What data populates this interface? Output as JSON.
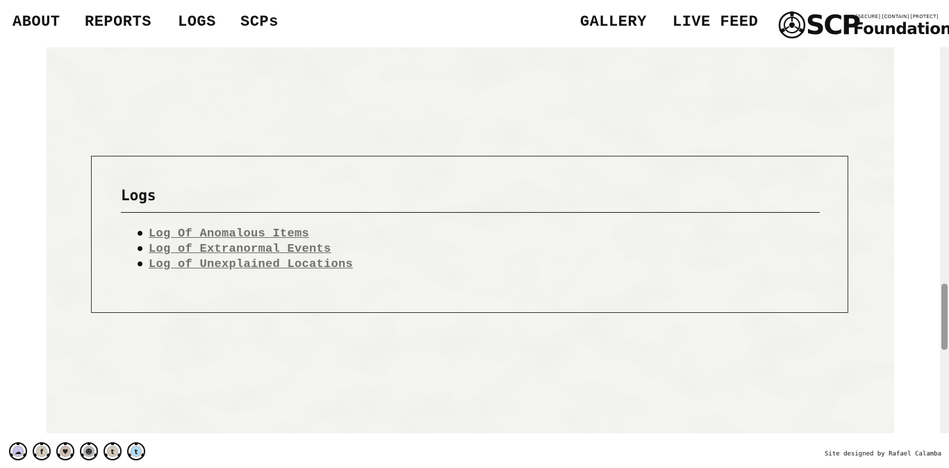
{
  "nav": {
    "left_links": [
      "ABOUT",
      "REPORTS",
      "LOGS",
      "SCPs"
    ],
    "right_links": [
      "GALLERY",
      "LIVE FEED"
    ]
  },
  "logo": {
    "wordmark": "SCP",
    "subtitle": "Foundation",
    "tagline": "[SECURE] [CONTAIN] [PROTECT]",
    "emblem_icon": "scp-emblem-icon"
  },
  "logs_section": {
    "title": "Logs",
    "items": [
      "Log Of Anomalous Items",
      "Log of Extranormal Events",
      "Log of Unexplained Locations"
    ]
  },
  "footer": {
    "social_icons": [
      {
        "name": "discord-icon",
        "glyph": "☁",
        "color": "#6a5acd"
      },
      {
        "name": "facebook-icon",
        "glyph": "f",
        "color": "#8a6d3b"
      },
      {
        "name": "heart-icon",
        "glyph": "♥",
        "color": "#7a3b1e"
      },
      {
        "name": "reddit-icon",
        "glyph": "☻",
        "color": "#333333"
      },
      {
        "name": "tumblr-icon",
        "glyph": "t",
        "color": "#8a6d3b"
      },
      {
        "name": "twitter-icon",
        "glyph": "t",
        "color": "#1da1f2"
      }
    ],
    "credit": "Site designed by Rafael Calamba"
  },
  "colors": {
    "link_gray": "#707070",
    "nav_text": "#111111",
    "marble_base": "#f3f3f0"
  }
}
